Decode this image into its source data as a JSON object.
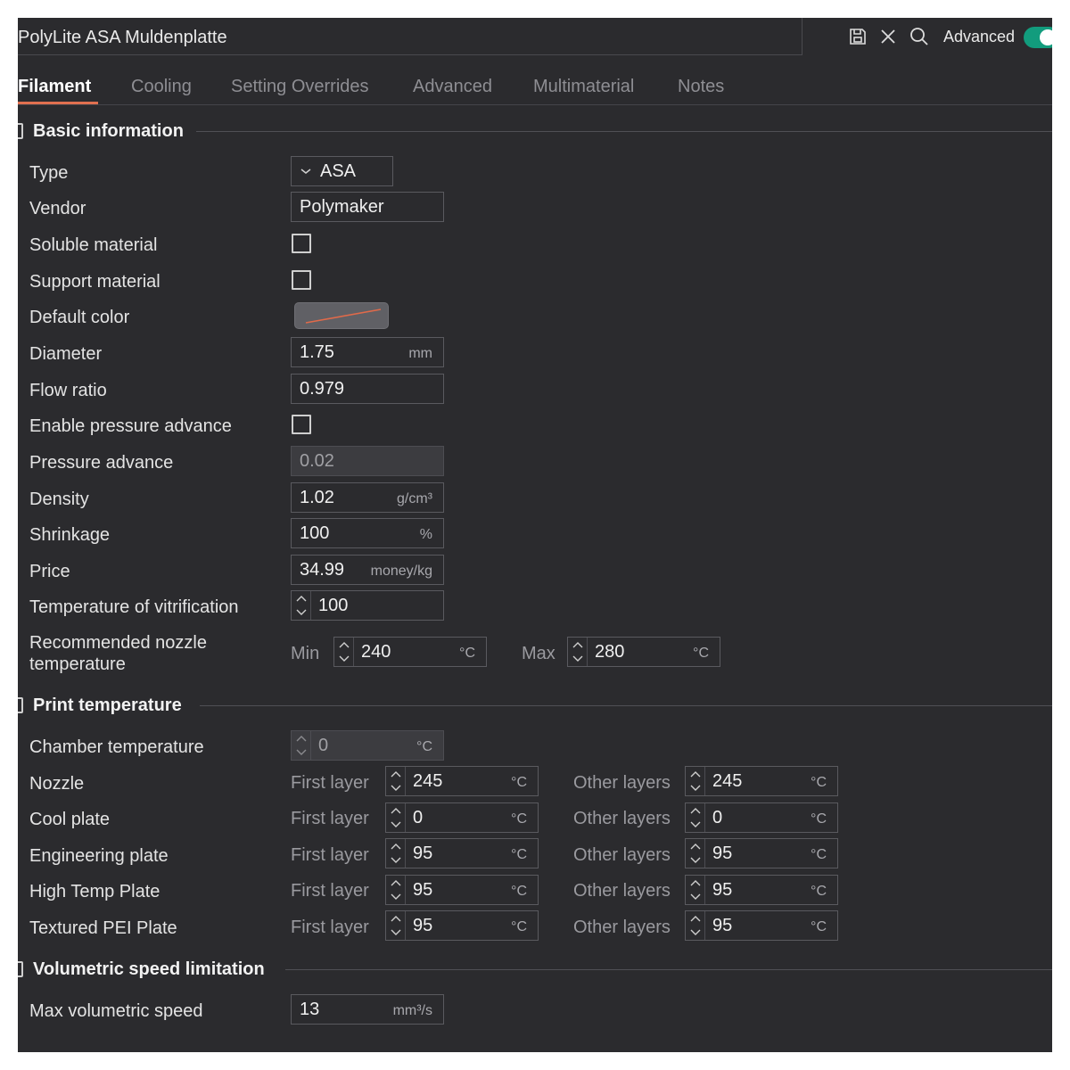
{
  "header": {
    "title": "PolyLite ASA Muldenplatte",
    "advanced_label": "Advanced",
    "advanced_on": true,
    "accent_color": "#129c7d"
  },
  "tabs": [
    {
      "label": "Filament",
      "active": true
    },
    {
      "label": "Cooling"
    },
    {
      "label": "Setting Overrides"
    },
    {
      "label": "Advanced"
    },
    {
      "label": "Multimaterial"
    },
    {
      "label": "Notes"
    }
  ],
  "basic": {
    "title": "Basic information",
    "type": {
      "label": "Type",
      "value": "ASA"
    },
    "vendor": {
      "label": "Vendor",
      "value": "Polymaker"
    },
    "soluble": {
      "label": "Soluble material",
      "checked": false
    },
    "support": {
      "label": "Support material",
      "checked": false
    },
    "color": {
      "label": "Default color",
      "swatch_line": "#e06a4a"
    },
    "diameter": {
      "label": "Diameter",
      "value": "1.75",
      "unit": "mm"
    },
    "flow": {
      "label": "Flow ratio",
      "value": "0.979"
    },
    "pa_enable": {
      "label": "Enable pressure advance",
      "checked": false
    },
    "pa": {
      "label": "Pressure advance",
      "value": "0.02"
    },
    "density": {
      "label": "Density",
      "value": "1.02",
      "unit": "g/cm³"
    },
    "shrinkage": {
      "label": "Shrinkage",
      "value": "100",
      "unit": "%"
    },
    "price": {
      "label": "Price",
      "value": "34.99",
      "unit": "money/kg"
    },
    "vitrification": {
      "label": "Temperature of vitrification",
      "value": "100"
    },
    "nozzle_rec": {
      "label_line1": "Recommended nozzle",
      "label_line2": "temperature",
      "min_label": "Min",
      "min_value": "240",
      "max_label": "Max",
      "max_value": "280",
      "unit": "°C"
    }
  },
  "print_temp": {
    "title": "Print temperature",
    "chamber": {
      "label": "Chamber temperature",
      "value": "0",
      "unit": "°C"
    },
    "first_label": "First layer",
    "other_label": "Other layers",
    "unit": "°C",
    "rows": [
      {
        "label": "Nozzle",
        "first": "245",
        "other": "245"
      },
      {
        "label": "Cool plate",
        "first": "0",
        "other": "0"
      },
      {
        "label": "Engineering plate",
        "first": "95",
        "other": "95"
      },
      {
        "label": "High Temp Plate",
        "first": "95",
        "other": "95"
      },
      {
        "label": "Textured PEI Plate",
        "first": "95",
        "other": "95"
      }
    ]
  },
  "volumetric": {
    "title": "Volumetric speed limitation",
    "max": {
      "label": "Max volumetric speed",
      "value": "13",
      "unit": "mm³/s"
    }
  }
}
